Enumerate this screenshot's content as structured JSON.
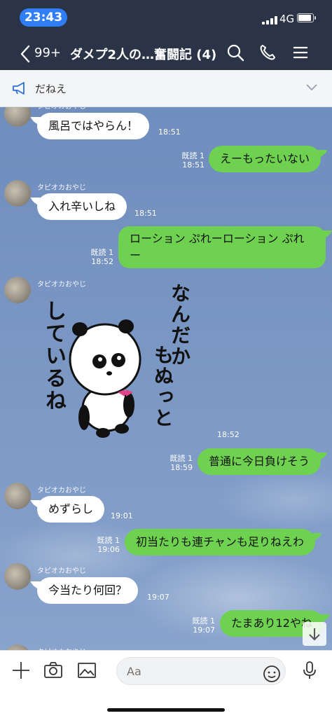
{
  "status": {
    "time": "23:43",
    "network": "4G",
    "battery_fraction": 0.95
  },
  "nav": {
    "unread_count": "99+",
    "title": "ダメプ2人の…奮闘記 (4)"
  },
  "announcement": {
    "text": "だねえ"
  },
  "sender_name": "タピオカおやじ",
  "messages": [
    {
      "side": "left",
      "text": "風呂ではやらん！",
      "time": "18:51"
    },
    {
      "side": "right",
      "text": "えーもったいない",
      "read": "既読 1",
      "time": "18:51"
    },
    {
      "side": "left",
      "text": "入れ辛いしね",
      "time": "18:51"
    },
    {
      "side": "right",
      "text": "ローション ぷれーローション ぷれー",
      "read": "既読 1",
      "time": "18:52"
    },
    {
      "side": "left",
      "type": "sticker",
      "time": "18:52"
    },
    {
      "side": "right",
      "text": "普通に今日負けそう",
      "read": "既読 1",
      "time": "18:59"
    },
    {
      "side": "left",
      "text": "めずらし",
      "time": "19:01"
    },
    {
      "side": "right",
      "text": "初当たりも連チャンも足りねえわ",
      "read": "既読 1",
      "time": "19:06"
    },
    {
      "side": "left",
      "text": "今当たり何回？",
      "time": "19:07"
    },
    {
      "side": "right",
      "text": "たまあり12やね",
      "read": "既読 1",
      "time": "19:07"
    }
  ],
  "sticker": {
    "line1": "なんだか",
    "line2": "もぬっと",
    "line3": "しているね"
  },
  "input": {
    "placeholder": "Aa"
  },
  "colors": {
    "header": "#2b3347",
    "bubble_right": "#6ed14f",
    "bubble_left": "#ffffff",
    "time_pill": "#2f7ef6"
  },
  "icons": [
    "back-chevron-icon",
    "search-icon",
    "phone-icon",
    "menu-icon",
    "megaphone-icon",
    "chevron-down-icon",
    "plus-icon",
    "camera-icon",
    "image-icon",
    "emoji-icon",
    "microphone-icon",
    "scroll-down-arrow-icon"
  ]
}
